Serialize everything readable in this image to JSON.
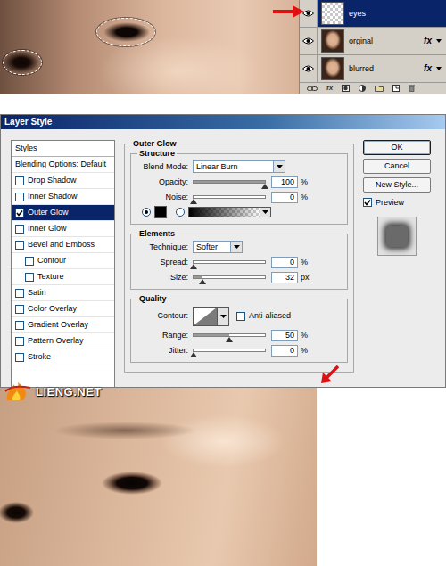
{
  "layers_panel": {
    "fx_label": "fx",
    "layers": [
      {
        "name": "eyes",
        "selected": true,
        "visible": true,
        "effects": false
      },
      {
        "name": "orginal",
        "selected": false,
        "visible": true,
        "effects": true
      },
      {
        "name": "blurred",
        "selected": false,
        "visible": true,
        "effects": true
      }
    ]
  },
  "dialog": {
    "title": "Layer Style",
    "styles_header": "Styles",
    "styles": [
      {
        "label": "Blending Options: Default",
        "kind": "option",
        "selected": false
      },
      {
        "label": "Drop Shadow",
        "kind": "check",
        "checked": false,
        "selected": false
      },
      {
        "label": "Inner Shadow",
        "kind": "check",
        "checked": false,
        "selected": false
      },
      {
        "label": "Outer Glow",
        "kind": "check",
        "checked": true,
        "selected": true
      },
      {
        "label": "Inner Glow",
        "kind": "check",
        "checked": false,
        "selected": false
      },
      {
        "label": "Bevel and Emboss",
        "kind": "check",
        "checked": false,
        "selected": false
      },
      {
        "label": "Contour",
        "kind": "subcheck",
        "checked": false,
        "selected": false
      },
      {
        "label": "Texture",
        "kind": "subcheck",
        "checked": false,
        "selected": false
      },
      {
        "label": "Satin",
        "kind": "check",
        "checked": false,
        "selected": false
      },
      {
        "label": "Color Overlay",
        "kind": "check",
        "checked": false,
        "selected": false
      },
      {
        "label": "Gradient Overlay",
        "kind": "check",
        "checked": false,
        "selected": false
      },
      {
        "label": "Pattern Overlay",
        "kind": "check",
        "checked": false,
        "selected": false
      },
      {
        "label": "Stroke",
        "kind": "check",
        "checked": false,
        "selected": false
      }
    ],
    "section": "Outer Glow",
    "structure": {
      "title": "Structure",
      "blend_mode": {
        "label": "Blend Mode:",
        "value": "Linear Burn"
      },
      "sliders": [
        {
          "label": "Opacity:",
          "value": "100",
          "unit": "%",
          "level": 1
        },
        {
          "label": "Noise:",
          "value": "0",
          "unit": "%",
          "level": 0
        }
      ],
      "fill_options": [
        {
          "kind": "color",
          "selected": true,
          "color": "#000000"
        },
        {
          "kind": "gradient",
          "selected": false,
          "color": "#000000"
        }
      ]
    },
    "elements": {
      "title": "Elements",
      "technique": {
        "label": "Technique:",
        "value": "Softer"
      },
      "sliders": [
        {
          "label": "Spread:",
          "value": "0",
          "unit": "%",
          "level": 0
        },
        {
          "label": "Size:",
          "value": "32",
          "unit": "px",
          "level": 0.13
        }
      ]
    },
    "quality": {
      "title": "Quality",
      "contour_label": "Contour:",
      "anti_aliased": {
        "label": "Anti-aliased",
        "checked": false
      },
      "sliders": [
        {
          "label": "Range:",
          "value": "50",
          "unit": "%",
          "level": 0.5
        },
        {
          "label": "Jitter:",
          "value": "0",
          "unit": "%",
          "level": 0
        }
      ]
    },
    "buttons": [
      {
        "label": "OK",
        "default": true
      },
      {
        "label": "Cancel",
        "default": false
      },
      {
        "label": "New Style...",
        "default": false
      }
    ],
    "preview": {
      "label": "Preview",
      "checked": true
    }
  },
  "watermark": "LIENG.NET"
}
